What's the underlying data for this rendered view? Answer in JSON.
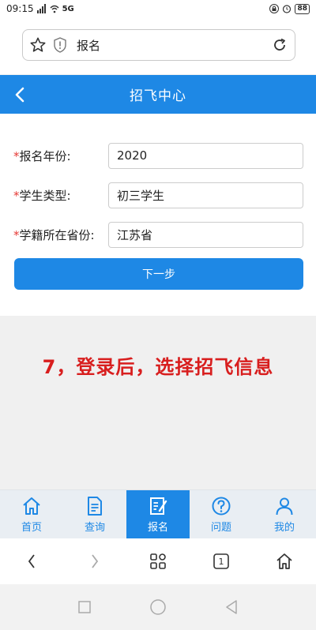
{
  "status_bar": {
    "time": "09:15",
    "net": "5G",
    "battery": "88"
  },
  "browser": {
    "url_text": "报名"
  },
  "header": {
    "title": "招飞中心"
  },
  "form": {
    "rows": [
      {
        "required_mark": "*",
        "label": "报名年份:",
        "value": "2020"
      },
      {
        "required_mark": "*",
        "label": "学生类型:",
        "value": "初三学生"
      },
      {
        "required_mark": "*",
        "label": "学籍所在省份:",
        "value": "江苏省"
      }
    ],
    "next_label": "下一步"
  },
  "caption": "7，登录后，选择招飞信息",
  "tabs": [
    {
      "label": "首页",
      "icon": "home-icon"
    },
    {
      "label": "查询",
      "icon": "document-icon"
    },
    {
      "label": "报名",
      "icon": "signup-icon",
      "active": true
    },
    {
      "label": "问题",
      "icon": "question-icon"
    },
    {
      "label": "我的",
      "icon": "user-icon"
    }
  ],
  "browser_nav": {
    "tab_count": "1"
  },
  "colors": {
    "accent": "#1e88e5",
    "caption": "#d81e1e",
    "required": "#e53935"
  }
}
